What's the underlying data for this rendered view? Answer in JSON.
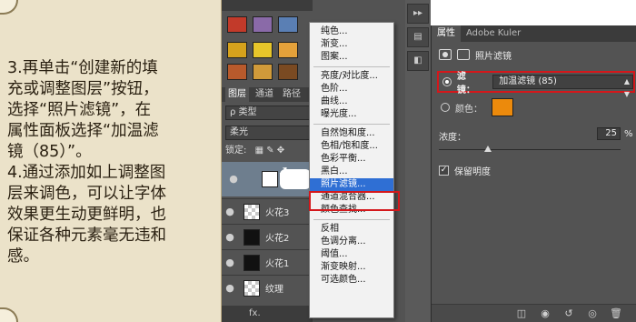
{
  "note": {
    "text": "3.再单击“创建新的填\n充或调整图层”按钮，\n选择“照片滤镜”，在\n属性面板选择“加温滤\n镜（85）”。\n4.通过添加如上调整图\n层来调色，可以让字体\n效果更生动更鲜明，也\n保证各种元素毫无违和\n感。"
  },
  "layers_panel": {
    "tabs": [
      "图层",
      "通道",
      "路径"
    ],
    "kind_filter": "ρ 类型",
    "blend_mode": "柔光",
    "lock_label": "锁定:",
    "layers": [
      {
        "name": "火花3"
      },
      {
        "name": "火花2"
      },
      {
        "name": "火花1"
      },
      {
        "name": "纹理"
      }
    ],
    "bottom_icons": "fx."
  },
  "adjustment_menu": {
    "items": [
      "纯色...",
      "渐变...",
      "图案...",
      "-",
      "亮度/对比度...",
      "色阶...",
      "曲线...",
      "曝光度...",
      "-",
      "自然饱和度...",
      "色相/饱和度...",
      "色彩平衡...",
      "黑白...",
      "照片滤镜...",
      "通道混合器...",
      "颜色查找...",
      "-",
      "反相",
      "色调分离...",
      "阈值...",
      "渐变映射...",
      "可选颜色..."
    ],
    "highlighted": "照片滤镜..."
  },
  "properties_panel": {
    "tabs": [
      "属性",
      "Adobe Kuler"
    ],
    "title": "照片滤镜",
    "filter_label": "滤镜：",
    "filter_value": "加温滤镜 (85)",
    "color_label": "颜色：",
    "color_swatch": "#ec8a0c",
    "density_label": "浓度：",
    "density_value": "25",
    "density_unit": "%",
    "density_fraction": 0.25,
    "preserve_luminosity": "保留明度",
    "collapse_glyph": "▸▸"
  },
  "colors": {
    "highlight_box": "#d4171b",
    "menu_selected": "#2f6fd4",
    "panel_bg": "#535353"
  }
}
